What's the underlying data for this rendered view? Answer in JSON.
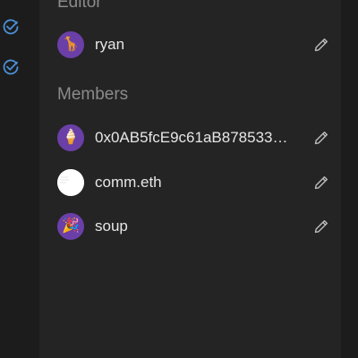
{
  "rail": {
    "icons": [
      "check-circle-icon",
      "check-circle-icon"
    ],
    "accent": "#4a8fd6"
  },
  "editor": {
    "title": "Editor",
    "members": [
      {
        "name": "ryan",
        "avatar": "🦒",
        "avatar_style": "purple",
        "icon": "pencil-icon"
      }
    ]
  },
  "members": {
    "title": "Members",
    "items": [
      {
        "name": "0x0AB5fcE9c61aB878533…",
        "avatar": "🍦",
        "avatar_style": "purple",
        "icon": "pencil-icon"
      },
      {
        "name": "comm.eth",
        "avatar": "",
        "avatar_style": "white",
        "icon": "pencil-icon"
      },
      {
        "name": "soup",
        "avatar": "🎉",
        "avatar_style": "purple",
        "icon": "pencil-icon"
      }
    ]
  },
  "colors": {
    "avatar_purple": "#6b3fa8",
    "text": "#e6e6e6",
    "muted": "#8b8b8b"
  }
}
